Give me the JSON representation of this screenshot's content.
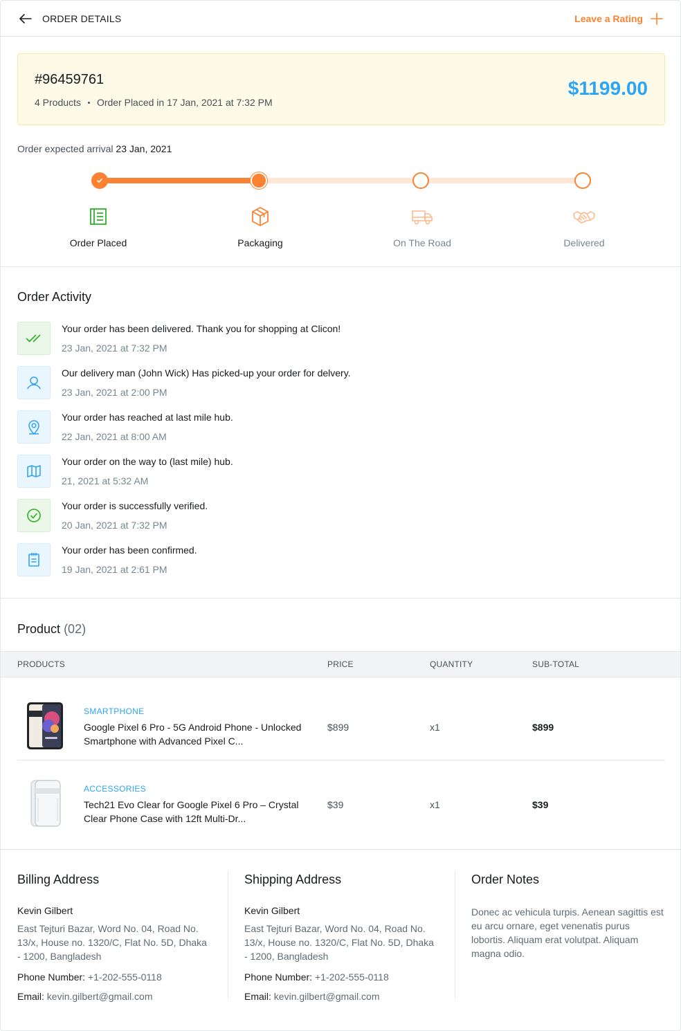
{
  "header": {
    "title": "ORDER DETAILS",
    "rating_label": "Leave a Rating"
  },
  "summary": {
    "order_id": "#96459761",
    "products_count": "4 Products",
    "placed": "Order Placed in 17 Jan, 2021 at 7:32 PM",
    "total": "$1199.00"
  },
  "arrival": {
    "label": "Order expected arrival",
    "date": "23 Jan, 2021"
  },
  "progress": {
    "steps": [
      {
        "label": "Order Placed",
        "state": "done"
      },
      {
        "label": "Packaging",
        "state": "current"
      },
      {
        "label": "On The Road",
        "state": "pending"
      },
      {
        "label": "Delivered",
        "state": "pending"
      }
    ]
  },
  "activity": {
    "title": "Order Activity",
    "items": [
      {
        "text": "Your order has been delivered. Thank you for shopping at Clicon!",
        "time": "23 Jan, 2021 at 7:32 PM",
        "icon": "double-check-icon"
      },
      {
        "text": "Our delivery man (John Wick) Has picked-up your order for delvery.",
        "time": "23 Jan, 2021 at 2:00 PM",
        "icon": "user-icon"
      },
      {
        "text": "Your order has reached at last mile hub.",
        "time": "22 Jan, 2021 at 8:00 AM",
        "icon": "map-pin-icon"
      },
      {
        "text": "Your order on the way to (last mile) hub.",
        "time": "21, 2021 at 5:32 AM",
        "icon": "map-icon"
      },
      {
        "text": "Your order is successfully verified.",
        "time": "20 Jan, 2021 at 7:32 PM",
        "icon": "check-circle-icon"
      },
      {
        "text": "Your order has been confirmed.",
        "time": "19 Jan, 2021 at 2:61 PM",
        "icon": "notepad-icon"
      }
    ]
  },
  "products": {
    "title": "Product",
    "count": "(02)",
    "columns": [
      "PRODUCTS",
      "PRICE",
      "QUANTITY",
      "SUB-TOTAL"
    ],
    "rows": [
      {
        "category": "SMARTPHONE",
        "name": "Google Pixel 6 Pro - 5G Android Phone - Unlocked Smartphone with Advanced Pixel C...",
        "price": "$899",
        "qty": "x1",
        "subtotal": "$899"
      },
      {
        "category": "ACCESSORIES",
        "name": "Tech21 Evo Clear for Google Pixel 6 Pro – Crystal Clear Phone Case with 12ft Multi-Dr...",
        "price": "$39",
        "qty": "x1",
        "subtotal": "$39"
      }
    ]
  },
  "billing": {
    "title": "Billing Address",
    "name": "Kevin Gilbert",
    "address": "East Tejturi Bazar, Word No. 04, Road No. 13/x, House no. 1320/C, Flat No. 5D, Dhaka - 1200, Bangladesh",
    "phone_label": "Phone Number:",
    "phone": "+1-202-555-0118",
    "email_label": "Email:",
    "email": "kevin.gilbert@gmail.com"
  },
  "shipping": {
    "title": "Shipping Address",
    "name": "Kevin Gilbert",
    "address": "East Tejturi Bazar, Word No. 04, Road No. 13/x, House no. 1320/C, Flat No. 5D, Dhaka - 1200, Bangladesh",
    "phone_label": "Phone Number:",
    "phone": "+1-202-555-0118",
    "email_label": "Email:",
    "email": "kevin.gilbert@gmail.com"
  },
  "notes": {
    "title": "Order Notes",
    "text": "Donec ac vehicula turpis. Aenean sagittis est eu arcu ornare, eget venenatis purus lobortis. Aliquam erat volutpat. Aliquam magna odio."
  },
  "colors": {
    "accent": "#FA8232",
    "price_blue": "#2DA5F3",
    "success_green": "#2DB224"
  }
}
